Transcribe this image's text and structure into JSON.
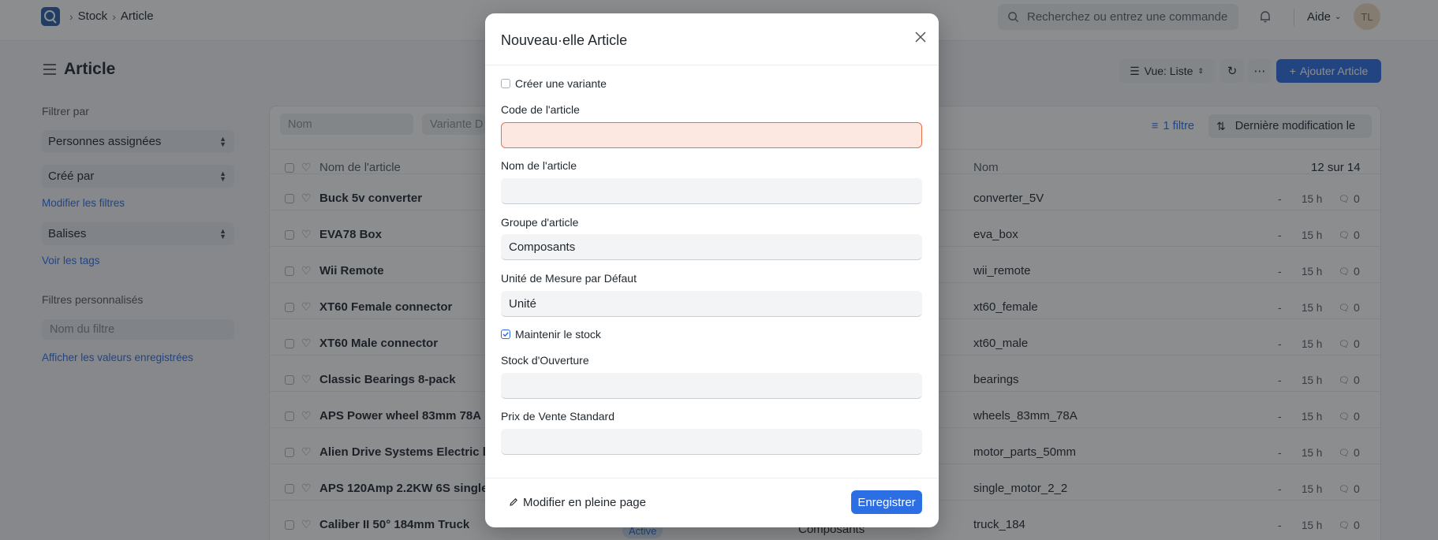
{
  "navbar": {
    "breadcrumbs": [
      "Stock",
      "Article"
    ],
    "search_placeholder": "Recherchez ou entrez une commande",
    "help_label": "Aide",
    "avatar_initials": "TL"
  },
  "page": {
    "title": "Article",
    "view_label": "Vue: Liste",
    "add_label": "Ajouter Article"
  },
  "sidebar": {
    "filter_by_label": "Filtrer par",
    "assigned_select": "Personnes assignées",
    "created_by_select": "Créé par",
    "edit_filters_link": "Modifier les filtres",
    "tags_select": "Balises",
    "show_tags_link": "Voir les tags",
    "custom_filters_label": "Filtres personnalisés",
    "filter_name_placeholder": "Nom du filtre",
    "saved_values_link": "Afficher les valeurs enregistrées"
  },
  "list": {
    "name_filter_placeholder": "Nom",
    "variant_filter_placeholder": "Variante D",
    "filter_button": "1 filtre",
    "sort_label": "Dernière modification le",
    "column_item_name": "Nom de l'article",
    "column_name": "Nom",
    "count_label": "12 sur 14",
    "rows": [
      {
        "name": "Buck 5v converter",
        "id": "converter_5V",
        "time": "15 h",
        "comments": "0"
      },
      {
        "name": "EVA78 Box",
        "id": "eva_box",
        "time": "15 h",
        "comments": "0"
      },
      {
        "name": "Wii Remote",
        "id": "wii_remote",
        "time": "15 h",
        "comments": "0"
      },
      {
        "name": "XT60 Female connector",
        "id": "xt60_female",
        "time": "15 h",
        "comments": "0"
      },
      {
        "name": "XT60 Male connector",
        "id": "xt60_male",
        "time": "15 h",
        "comments": "0"
      },
      {
        "name": "Classic Bearings 8-pack",
        "id": "bearings",
        "time": "15 h",
        "comments": "0"
      },
      {
        "name": "APS Power wheel 83mm 78A",
        "id": "wheels_83mm_78A",
        "time": "15 h",
        "comments": "0"
      },
      {
        "name": "Alien Drive Systems Electric long",
        "id": "motor_parts_50mm",
        "time": "15 h",
        "comments": "0"
      },
      {
        "name": "APS 120Amp 2.2KW 6S single m",
        "id": "single_motor_2_2",
        "time": "15 h",
        "comments": "0"
      },
      {
        "name": "Caliber II 50° 184mm Truck",
        "id": "truck_184",
        "time": "15 h",
        "comments": "0"
      }
    ],
    "last_row_status": "Active",
    "last_row_group": "Composants",
    "row_dash": "-"
  },
  "modal": {
    "title": "Nouveau·elle Article",
    "create_variant_label": "Créer une variante",
    "item_code_label": "Code de l'article",
    "item_code_value": "",
    "item_name_label": "Nom de l'article",
    "item_name_value": "",
    "item_group_label": "Groupe d'article",
    "item_group_value": "Composants",
    "uom_label": "Unité de Mesure par Défaut",
    "uom_value": "Unité",
    "maintain_stock_label": "Maintenir le stock",
    "opening_stock_label": "Stock d'Ouverture",
    "opening_stock_value": "",
    "selling_price_label": "Prix de Vente Standard",
    "selling_price_value": "",
    "full_page_label": "Modifier en pleine page",
    "save_label": "Enregistrer"
  },
  "colors": {
    "accent": "#2c6ee3",
    "error_field": "#fde8e1"
  }
}
